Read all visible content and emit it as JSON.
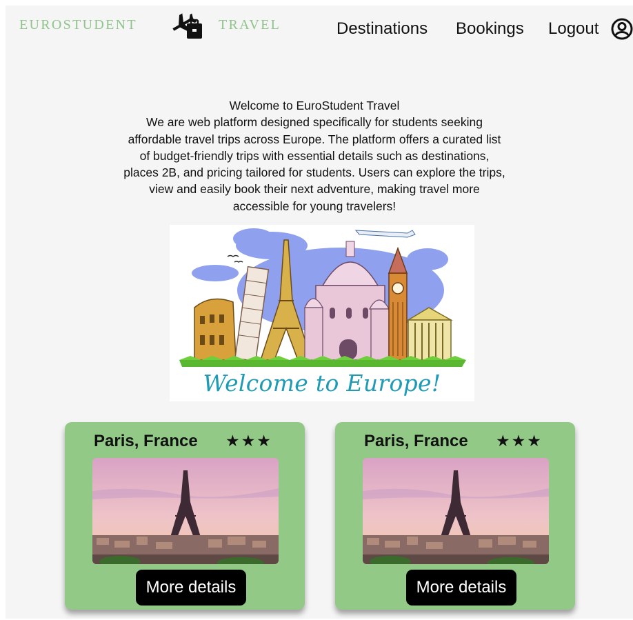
{
  "header": {
    "brand_left": "EUROSTUDENT",
    "brand_right": "TRAVEL",
    "logo_icon": "plane-luggage-icon",
    "nav": {
      "destinations": "Destinations",
      "bookings": "Bookings",
      "logout": "Logout"
    },
    "account_icon": "account-circle-icon"
  },
  "intro": {
    "lines": [
      "Welcome to EuroStudent Travel",
      "We are web platform designed specifically for students seeking",
      "affordable travel trips across Europe. The platform offers a curated list",
      "of budget-friendly trips with essential details such as destinations,",
      "places 2B, and pricing tailored for students. Users can explore the trips,",
      "view and easily book their next adventure, making travel more",
      "accessible for young travelers!"
    ]
  },
  "hero": {
    "caption": "Welcome to Europe!"
  },
  "trips": [
    {
      "title": "Paris, France",
      "stars": "★★★",
      "button_label": "More details"
    },
    {
      "title": "Paris, France",
      "stars": "★★★",
      "button_label": "More details"
    }
  ],
  "colors": {
    "brand_green": "#8fc48a",
    "card_green": "#93c986",
    "caption_teal": "#1f9bb5",
    "button_black": "#000000",
    "page_background": "#f5f5f5"
  }
}
